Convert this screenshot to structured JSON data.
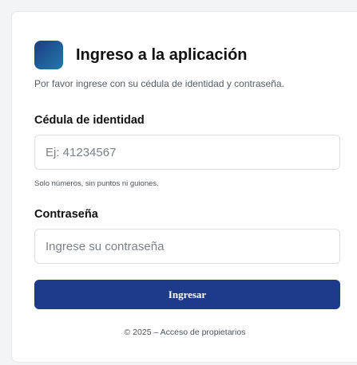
{
  "header": {
    "logo_icon": "app-logo-icon",
    "title": "Ingreso a la aplicación"
  },
  "subtitle": "Por favor ingrese con su cédula de identidad y contraseña.",
  "form": {
    "cedula": {
      "label": "Cédula de identidad",
      "placeholder": "Ej: 41234567",
      "value": "",
      "hint": "Solo números, sin puntos ni guiones."
    },
    "password": {
      "label": "Contraseña",
      "placeholder": "Ingrese su contraseña",
      "value": ""
    },
    "submit_label": "Ingresar"
  },
  "footer": "© 2025 – Acceso de propietarios",
  "colors": {
    "primary": "#1e3a8a",
    "background": "#f3f4f6",
    "card": "#ffffff"
  }
}
